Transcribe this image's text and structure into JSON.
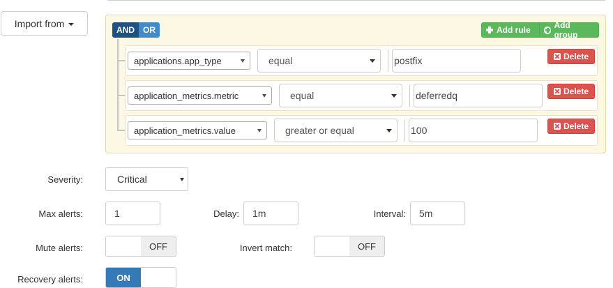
{
  "import_button": {
    "label": "Import from"
  },
  "query": {
    "and_label": "AND",
    "or_label": "OR",
    "add_rule_label": "Add rule",
    "add_group_label": "Add group",
    "delete_label": "Delete",
    "rules": [
      {
        "field": "applications.app_type",
        "operator": "equal",
        "value": "postfix"
      },
      {
        "field": "application_metrics.metric",
        "operator": "equal",
        "value": "deferredq"
      },
      {
        "field": "application_metrics.value",
        "operator": "greater or equal",
        "value": "100"
      }
    ]
  },
  "form": {
    "severity_label": "Severity:",
    "severity_value": "Critical",
    "max_alerts_label": "Max alerts:",
    "max_alerts_value": "1",
    "delay_label": "Delay:",
    "delay_value": "1m",
    "interval_label": "Interval:",
    "interval_value": "5m",
    "mute_alerts_label": "Mute alerts:",
    "mute_alerts_state": "OFF",
    "invert_match_label": "Invert match:",
    "invert_match_state": "OFF",
    "recovery_alerts_label": "Recovery alerts:",
    "recovery_alerts_state": "ON"
  },
  "colors": {
    "and_active": "#1f5280",
    "or_inactive": "#428bca",
    "add_green": "#5cb85c",
    "delete_red": "#d9534f",
    "group_bg": "#fcf8e3",
    "toggle_on": "#337ab7"
  }
}
